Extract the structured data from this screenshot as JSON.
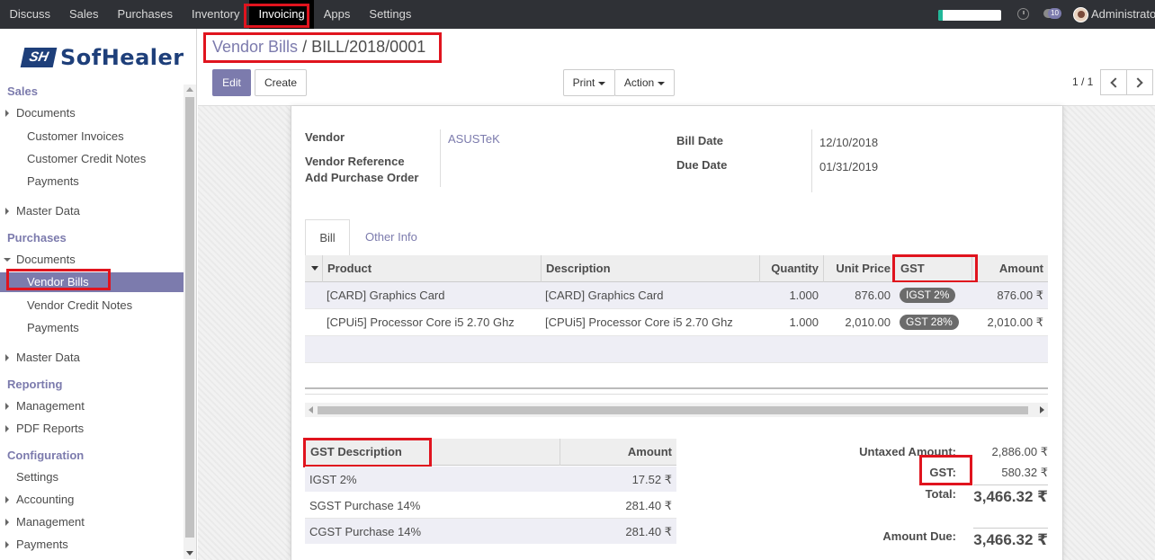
{
  "topbar": {
    "menu": [
      "Discuss",
      "Sales",
      "Purchases",
      "Inventory",
      "Invoicing",
      "Apps",
      "Settings"
    ],
    "active": "Invoicing",
    "chat_count": "10",
    "user": "Administrator",
    "progress_fraction": 0.07,
    "icons": [
      "clock-icon",
      "chat-icon",
      "avatar"
    ]
  },
  "sidebar": {
    "logo": "SofHealer",
    "logo_mark": "SH",
    "sales": "Sales",
    "sales_documents": "Documents",
    "customer_invoices": "Customer Invoices",
    "customer_credit_notes": "Customer Credit Notes",
    "sales_payments": "Payments",
    "sales_master_data": "Master Data",
    "purchases": "Purchases",
    "purchases_documents": "Documents",
    "vendor_bills": "Vendor Bills",
    "vendor_credit_notes": "Vendor Credit Notes",
    "purchases_payments": "Payments",
    "purchases_master_data": "Master Data",
    "reporting": "Reporting",
    "management": "Management",
    "pdf_reports": "PDF Reports",
    "configuration": "Configuration",
    "settings": "Settings",
    "accounting": "Accounting",
    "config_management": "Management",
    "config_payments": "Payments"
  },
  "breadcrumb": {
    "parent": "Vendor Bills",
    "separator": "/",
    "current": "BILL/2018/0001"
  },
  "toolbar": {
    "edit": "Edit",
    "create": "Create",
    "print": "Print",
    "action": "Action",
    "pager": "1 / 1"
  },
  "form": {
    "vendor_label": "Vendor",
    "vendor_value": "ASUSTeK",
    "vendor_reference_label": "Vendor Reference",
    "add_po_label": "Add Purchase Order",
    "bill_date_label": "Bill Date",
    "bill_date_value": "12/10/2018",
    "due_date_label": "Due Date",
    "due_date_value": "01/31/2019"
  },
  "tabs": {
    "bill": "Bill",
    "other_info": "Other Info"
  },
  "lines": {
    "headers": {
      "product": "Product",
      "description": "Description",
      "quantity": "Quantity",
      "unit_price": "Unit Price",
      "gst": "GST",
      "amount": "Amount"
    },
    "rows": [
      {
        "product": "[CARD] Graphics Card",
        "description": "[CARD] Graphics Card",
        "quantity": "1.000",
        "unit_price": "876.00",
        "gst": "IGST 2%",
        "amount": "876.00 ₹"
      },
      {
        "product": "[CPUi5] Processor Core i5 2.70 Ghz",
        "description": "[CPUi5] Processor Core i5 2.70 Ghz",
        "quantity": "1.000",
        "unit_price": "2,010.00",
        "gst": "GST 28%",
        "amount": "2,010.00 ₹"
      }
    ]
  },
  "gst_table": {
    "headers": {
      "description": "GST Description",
      "amount": "Amount"
    },
    "rows": [
      {
        "description": "IGST 2%",
        "amount": "17.52 ₹"
      },
      {
        "description": "SGST Purchase 14%",
        "amount": "281.40 ₹"
      },
      {
        "description": "CGST Purchase 14%",
        "amount": "281.40 ₹"
      }
    ]
  },
  "totals": {
    "untaxed_label": "Untaxed Amount:",
    "untaxed_value": "2,886.00 ₹",
    "gst_label": "GST:",
    "gst_value": "580.32 ₹",
    "total_label": "Total:",
    "total_value": "3,466.32 ₹",
    "due_label": "Amount Due:",
    "due_value": "3,466.32 ₹"
  },
  "colors": {
    "brand": "#7c7bad",
    "navbar": "#2f3136",
    "highlight_box": "#e0141e",
    "tag": "#6b6b6b"
  }
}
